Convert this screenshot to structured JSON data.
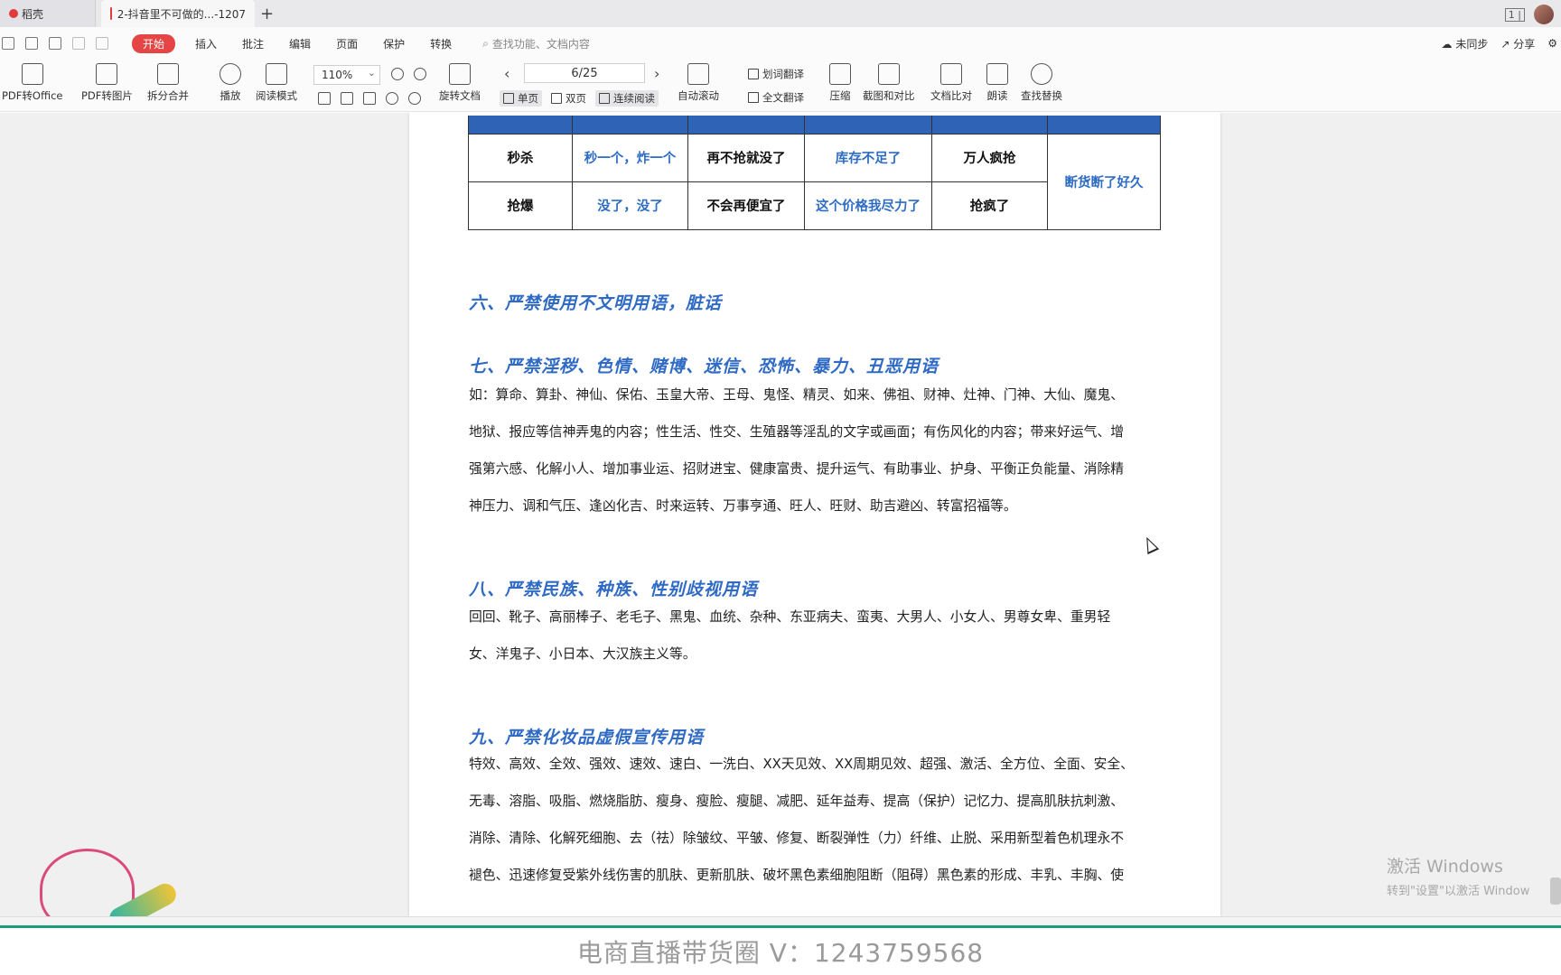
{
  "tabs": [
    {
      "label": "稻壳"
    },
    {
      "label": "2-抖音里不可做的...-1207"
    }
  ],
  "menu": {
    "items": [
      "开始",
      "插入",
      "批注",
      "编辑",
      "页面",
      "保护",
      "转换"
    ],
    "search_placeholder": "查找功能、文档内容",
    "sync": "未同步",
    "share": "分享"
  },
  "toolbar": {
    "pdf_to_office": "PDF转Office",
    "pdf_to_image": "PDF转图片",
    "split_merge": "拆分合并",
    "play": "播放",
    "read_mode": "阅读模式",
    "zoom": "110%",
    "rotate": "旋转文档",
    "page_indicator": "6/25",
    "single": "单页",
    "double": "双页",
    "continuous": "连续阅读",
    "auto_scroll": "自动滚动",
    "word_translate": "划词翻译",
    "full_translate": "全文翻译",
    "compress": "压缩",
    "screenshot_compare": "截图和对比",
    "doc_compare": "文档比对",
    "read_aloud": "朗读",
    "find_replace": "查找替换"
  },
  "table": {
    "rows": [
      [
        "秒杀",
        "秒一个，炸一个",
        "再不抢就没了",
        "库存不足了",
        "万人疯抢"
      ],
      [
        "抢爆",
        "没了，没了",
        "不会再便宜了",
        "这个价格我尽力了",
        "抢疯了"
      ]
    ],
    "merged_last": "断货断了好久"
  },
  "sections": {
    "s6": "六、严禁使用不文明用语，脏话",
    "s7": "七、严禁淫秽、色情、赌博、迷信、恐怖、暴力、丑恶用语",
    "s7_lines": [
      "如：算命、算卦、神仙、保佑、玉皇大帝、王母、鬼怪、精灵、如来、佛祖、财神、灶神、门神、大仙、魔鬼、",
      "地狱、报应等信神弄鬼的内容；性生活、性交、生殖器等淫乱的文字或画面；有伤风化的内容；带来好运气、增",
      "强第六感、化解小人、增加事业运、招财进宝、健康富贵、提升运气、有助事业、护身、平衡正负能量、消除精",
      "神压力、调和气压、逢凶化吉、时来运转、万事亨通、旺人、旺财、助吉避凶、转富招福等。"
    ],
    "s8": "八、严禁民族、种族、性别歧视用语",
    "s8_lines": [
      "回回、靴子、高丽棒子、老毛子、黑鬼、血统、杂种、东亚病夫、蛮夷、大男人、小女人、男尊女卑、重男轻",
      "女、洋鬼子、小日本、大汉族主义等。"
    ],
    "s9": "九、严禁化妆品虚假宣传用语",
    "s9_lines": [
      "特效、高效、全效、强效、速效、速白、一洗白、XX天见效、XX周期见效、超强、激活、全方位、全面、安全、",
      "无毒、溶脂、吸脂、燃烧脂肪、瘦身、瘦脸、瘦腿、减肥、延年益寿、提高（保护）记忆力、提高肌肤抗刺激、",
      "消除、清除、化解死细胞、去（祛）除皱纹、平皱、修复、断裂弹性（力）纤维、止脱、采用新型着色机理永不",
      "褪色、迅速修复受紫外线伤害的肌肤、更新肌肤、破坏黑色素细胞阻断（阻碍）黑色素的形成、丰乳、丰胸、使"
    ]
  },
  "watermark": {
    "line1": "激活 Windows",
    "line2": "转到\"设置\"以激活 Window"
  },
  "footer": "电商直播带货圈 V：1243759568"
}
